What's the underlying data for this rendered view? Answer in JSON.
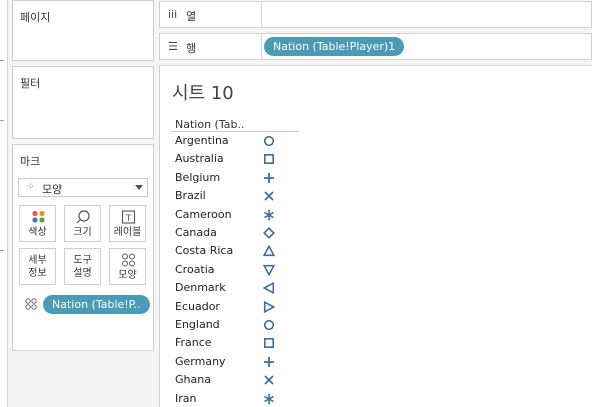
{
  "pages_panel": {
    "title": "페이지"
  },
  "filters_panel": {
    "title": "필터"
  },
  "marks_panel": {
    "title": "마크",
    "mark_type": "모양",
    "buttons": {
      "color": "색상",
      "size": "크기",
      "label": "레이블",
      "detail": "세부\n정보",
      "tooltip": "도구\n설명",
      "shape": "모양"
    },
    "shape_pill": "Nation (Table!P.."
  },
  "columns_shelf": {
    "icon": "iii",
    "label": "열"
  },
  "rows_shelf": {
    "icon": "☰",
    "label": "행",
    "pill": "Nation (Table!Player)1"
  },
  "sheet": {
    "title": "시트 10",
    "column_header": "Nation (Tab..",
    "rows": [
      {
        "name": "Argentina",
        "shape": "circle"
      },
      {
        "name": "Australia",
        "shape": "square"
      },
      {
        "name": "Belgium",
        "shape": "plus"
      },
      {
        "name": "Brazil",
        "shape": "times"
      },
      {
        "name": "Cameroon",
        "shape": "asterisk"
      },
      {
        "name": "Canada",
        "shape": "diamond"
      },
      {
        "name": "Costa Rica",
        "shape": "triangle-up"
      },
      {
        "name": "Croatia",
        "shape": "triangle-down"
      },
      {
        "name": "Denmark",
        "shape": "triangle-left"
      },
      {
        "name": "Ecuador",
        "shape": "triangle-right"
      },
      {
        "name": "England",
        "shape": "circle"
      },
      {
        "name": "France",
        "shape": "square"
      },
      {
        "name": "Germany",
        "shape": "plus"
      },
      {
        "name": "Ghana",
        "shape": "times"
      },
      {
        "name": "Iran",
        "shape": "asterisk"
      }
    ]
  },
  "colors": {
    "pill": "#4b9bb6",
    "shape": "#3f6f9c"
  }
}
